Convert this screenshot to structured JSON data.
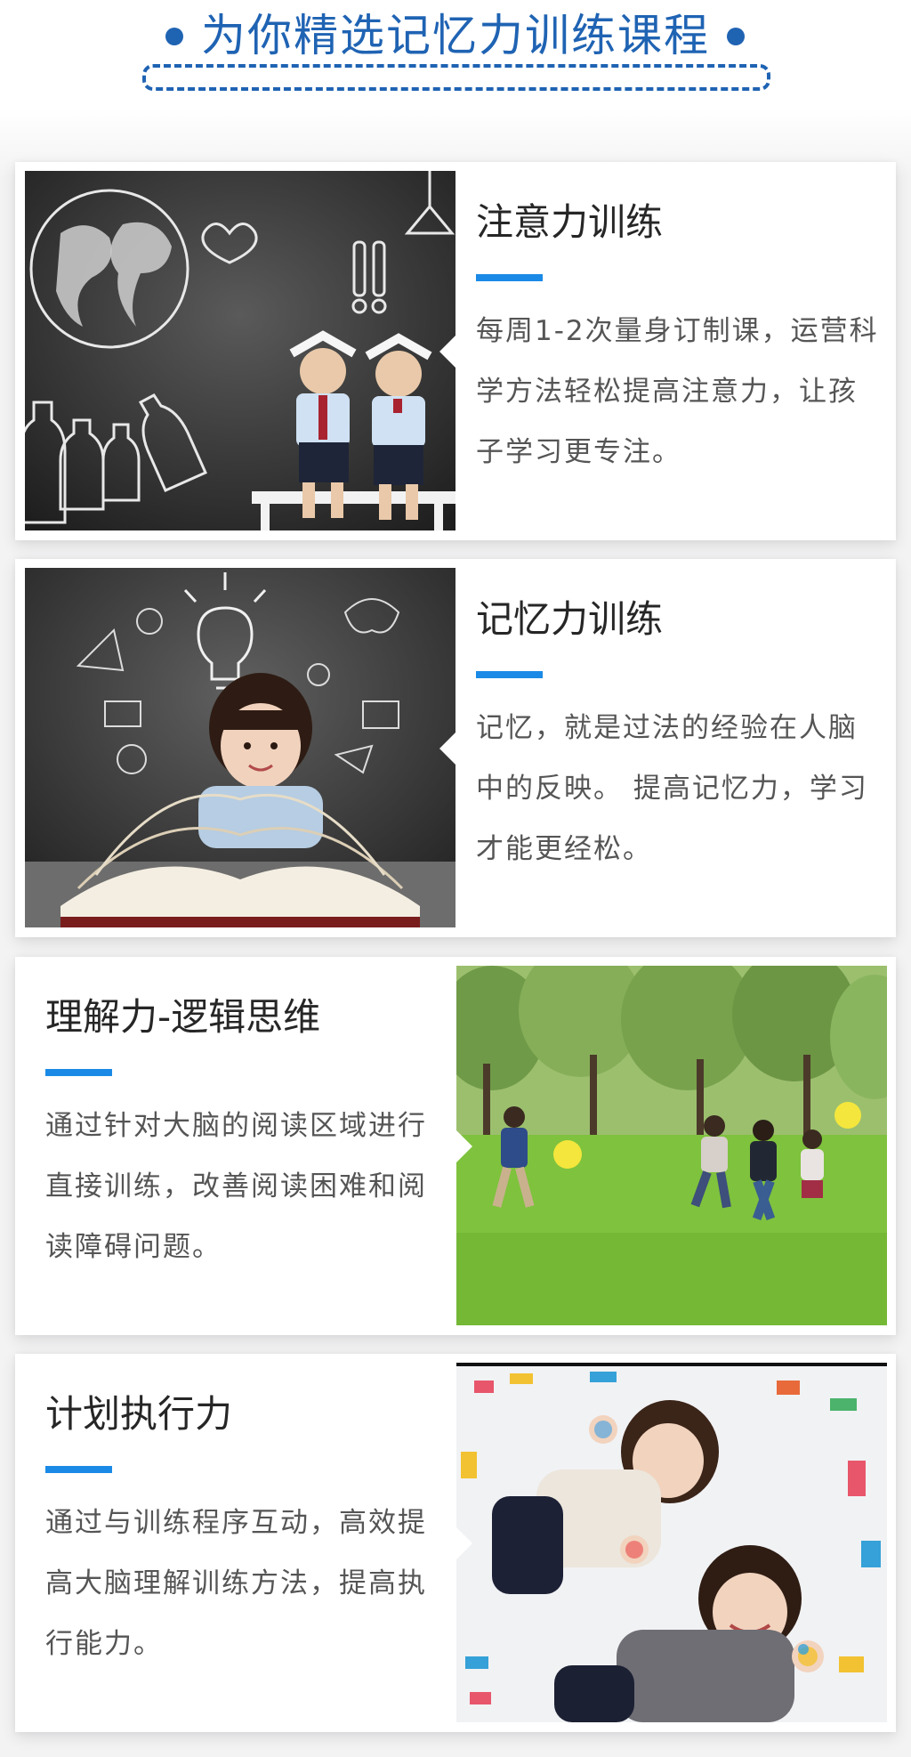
{
  "header": {
    "title": "为你精选记忆力训练课程"
  },
  "colors": {
    "accent": "#1a8ae6",
    "header_blue": "#1f63b3"
  },
  "courses": [
    {
      "title": "注意力训练",
      "description": "每周1-2次量身订制课，运营科学方法轻松提高注意力，让孩子学习更专注。",
      "image": "two-children-with-books-on-heads-chalkboard-photo"
    },
    {
      "title": "记忆力训练",
      "description": "记忆，就是过法的经验在人脑中的反映。 提高记忆力，学习才能更经松。",
      "image": "girl-with-open-book-and-lightbulb-chalkboard-photo"
    },
    {
      "title": "理解力-逻辑思维",
      "description": "通过针对大脑的阅读区域进行直接训练，改善阅读困难和阅读障碍问题。",
      "image": "children-running-in-park-photo"
    },
    {
      "title": "计划执行力",
      "description": "通过与训练程序互动，高效提高大脑理解训练方法，提高执行能力。",
      "image": "two-kids-with-painted-hands-photo"
    }
  ]
}
